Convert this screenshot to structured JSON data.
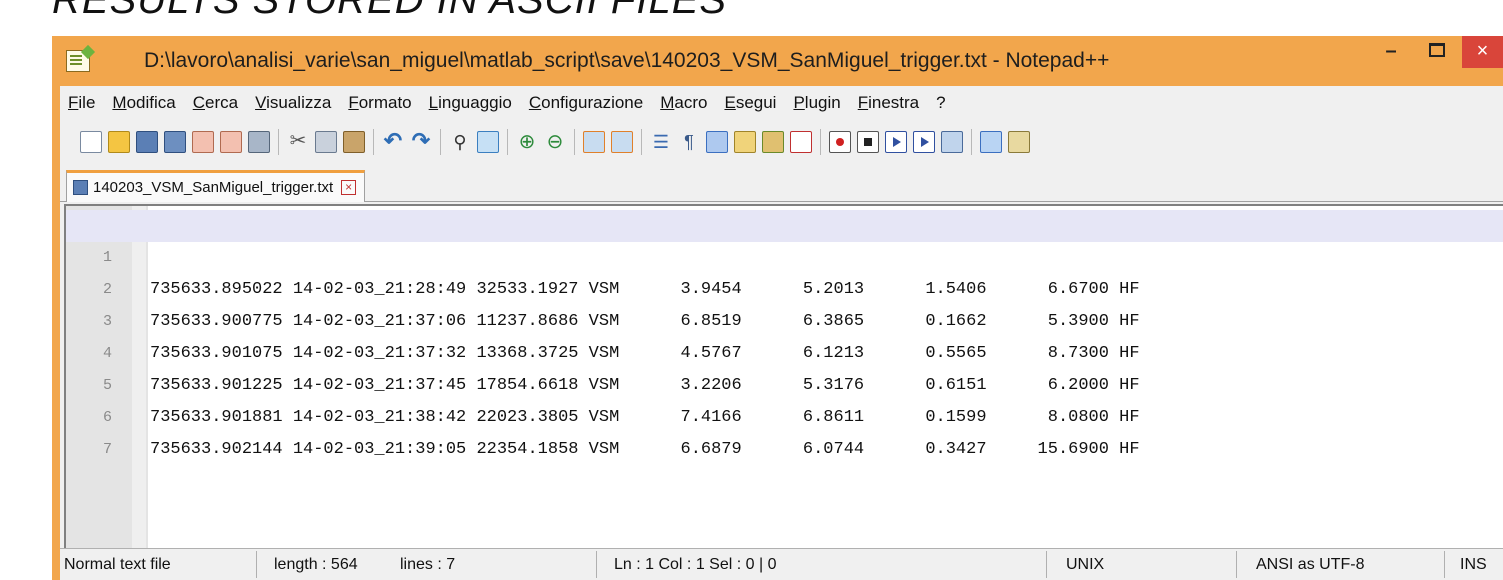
{
  "slide": {
    "title": "RESULTS STORED IN ASCII FILES"
  },
  "window": {
    "title": "D:\\lavoro\\analisi_varie\\san_miguel\\matlab_script\\save\\140203_VSM_SanMiguel_trigger.txt - Notepad++",
    "minimize": "–",
    "close": "×"
  },
  "menu": [
    "File",
    "Modifica",
    "Cerca",
    "Visualizza",
    "Formato",
    "Linguaggio",
    "Configurazione",
    "Macro",
    "Esegui",
    "Plugin",
    "Finestra",
    "?"
  ],
  "toolbar_icons": [
    "new-file-icon",
    "open-file-icon",
    "save-icon",
    "save-all-icon",
    "close-file-icon",
    "close-all-icon",
    "print-icon",
    "cut-icon",
    "copy-icon",
    "paste-icon",
    "undo-icon",
    "redo-icon",
    "find-icon",
    "replace-icon",
    "zoom-in-icon",
    "zoom-out-icon",
    "sync-scroll-icon",
    "word-wrap-icon",
    "show-all-chars-icon",
    "indent-guide-icon",
    "language-icon",
    "doc-map-icon",
    "function-list-icon",
    "record-macro-icon",
    "stop-macro-icon",
    "play-macro-icon",
    "play-macro-multiple-icon",
    "save-macro-icon",
    "spell-check-icon",
    "spell-check-alt-icon"
  ],
  "tab": {
    "label": "140203_VSM_SanMiguel_trigger.txt",
    "close": "×"
  },
  "editor": {
    "lines": [
      {
        "num": "1",
        "text": "735633.895022 14-02-03_21:28:49 32533.1927 VSM      3.9454      5.2013      1.5406      6.6700 HF"
      },
      {
        "num": "2",
        "text": "735633.900775 14-02-03_21:37:06 11237.8686 VSM      6.8519      6.3865      0.1662      5.3900 HF"
      },
      {
        "num": "3",
        "text": "735633.901075 14-02-03_21:37:32 13368.3725 VSM      4.5767      6.1213      0.5565      8.7300 HF"
      },
      {
        "num": "4",
        "text": "735633.901225 14-02-03_21:37:45 17854.6618 VSM      3.2206      5.3176      0.6151      6.2000 HF"
      },
      {
        "num": "5",
        "text": "735633.901881 14-02-03_21:38:42 22023.3805 VSM      7.4166      6.8611      0.1599      8.0800 HF"
      },
      {
        "num": "6",
        "text": "735633.902144 14-02-03_21:39:05 22354.1858 VSM      6.6879      6.0744      0.3427     15.6900 HF"
      },
      {
        "num": "7",
        "text": ""
      }
    ]
  },
  "status": {
    "filetype": "Normal text file",
    "length": "length : 564",
    "lines": "lines : 7",
    "position": "Ln : 1    Col : 1    Sel : 0 | 0",
    "eol": "UNIX",
    "encoding": "ANSI as UTF-8",
    "mode": "INS"
  },
  "colors": {
    "window_frame": "#f2a64c",
    "close_button": "#d9453a",
    "current_line": "#e6e6f6"
  }
}
